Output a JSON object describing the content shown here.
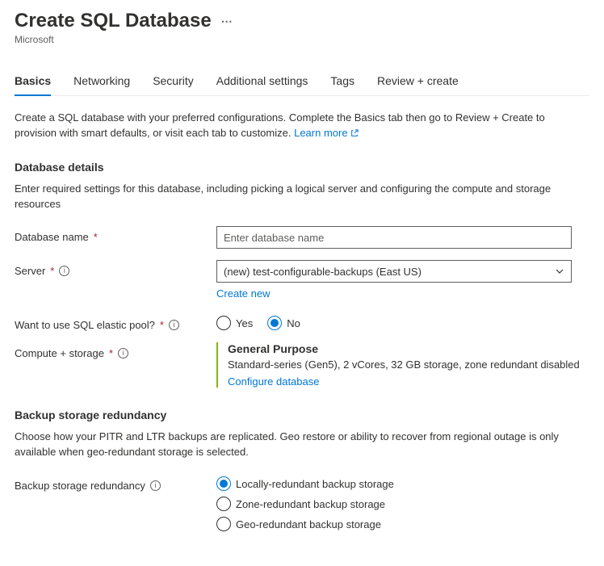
{
  "header": {
    "title": "Create SQL Database",
    "subtitle": "Microsoft"
  },
  "tabs": [
    {
      "label": "Basics",
      "active": true
    },
    {
      "label": "Networking",
      "active": false
    },
    {
      "label": "Security",
      "active": false
    },
    {
      "label": "Additional settings",
      "active": false
    },
    {
      "label": "Tags",
      "active": false
    },
    {
      "label": "Review + create",
      "active": false
    }
  ],
  "intro": {
    "text": "Create a SQL database with your preferred configurations. Complete the Basics tab then go to Review + Create to provision with smart defaults, or visit each tab to customize. ",
    "learn_more": "Learn more"
  },
  "db_details": {
    "title": "Database details",
    "desc": "Enter required settings for this database, including picking a logical server and configuring the compute and storage resources",
    "name_label": "Database name",
    "name_placeholder": "Enter database name",
    "name_value": "",
    "server_label": "Server",
    "server_value": "(new) test-configurable-backups (East US)",
    "create_new": "Create new",
    "pool_label": "Want to use SQL elastic pool?",
    "pool_yes": "Yes",
    "pool_no": "No",
    "pool_selected": "No",
    "compute_label": "Compute + storage",
    "compute_tier": "General Purpose",
    "compute_desc": "Standard-series (Gen5), 2 vCores, 32 GB storage, zone redundant disabled",
    "configure_link": "Configure database"
  },
  "backup": {
    "title": "Backup storage redundancy",
    "desc": "Choose how your PITR and LTR backups are replicated. Geo restore or ability to recover from regional outage is only available when geo-redundant storage is selected.",
    "label": "Backup storage redundancy",
    "options": [
      "Locally-redundant backup storage",
      "Zone-redundant backup storage",
      "Geo-redundant backup storage"
    ],
    "selected": "Locally-redundant backup storage"
  }
}
